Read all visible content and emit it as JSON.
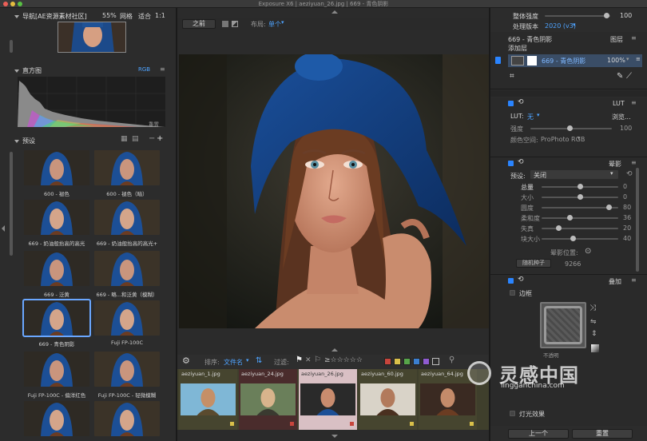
{
  "window": {
    "title": "Exposure X6 | aeziyuan_26.jpg | 669 - 青色阴影"
  },
  "navigator": {
    "title": "导航[AE资源素材社区]",
    "zoom": "55%",
    "grid": "网格",
    "fit": "适合",
    "ratio": "1:1"
  },
  "histogram": {
    "title": "直方图",
    "mode": "RGB",
    "reset": "重置"
  },
  "presets": {
    "title": "预设",
    "items": [
      {
        "label": "600 - 褪色"
      },
      {
        "label": "600 - 褪色（暗）"
      },
      {
        "label": "669 - 奶油般抬高的高光"
      },
      {
        "label": "669 - 奶油般抬高的高光+"
      },
      {
        "label": "669 - 泛黄"
      },
      {
        "label": "669 - 略...和泛黄（模糊）"
      },
      {
        "label": "669 - 青色阴影"
      },
      {
        "label": "Fuji FP-100C"
      },
      {
        "label": "Fuji FP-100C - 偏洋红色"
      },
      {
        "label": "Fuji FP-100C - 轻微模糊"
      },
      {
        "label": ""
      },
      {
        "label": ""
      }
    ]
  },
  "viewer": {
    "before": "之前",
    "layout_label": "布局:",
    "layout_value": "单个"
  },
  "filmstrip": {
    "sort_label": "排序:",
    "sort_value": "文件名",
    "filter_label": "过滤:",
    "files": [
      {
        "name": "aeziyuan_1.jpg"
      },
      {
        "name": "aeziyuan_24.jpg"
      },
      {
        "name": "aeziyuan_26.jpg"
      },
      {
        "name": "aeziyuan_60.jpg"
      },
      {
        "name": "aeziyuan_64.jpg"
      }
    ],
    "color_labels": [
      "#c8453c",
      "#d9c04a",
      "#57a54a",
      "#3b7fd1",
      "#8f5bd1"
    ]
  },
  "right": {
    "overall_intensity_label": "整体强度",
    "overall_intensity_value": "100",
    "process_version_label": "处理版本",
    "process_version_value": "2020 (v3)",
    "layers_title": "669 - 青色阴影",
    "layers_label": "图层",
    "add_layer": "添加层",
    "layer_name": "669 - 青色阴影",
    "layer_opacity": "100%",
    "lut": {
      "title": "LUT",
      "lut_label": "LUT:",
      "lut_value": "无",
      "browse": "浏览...",
      "strength_label": "强度",
      "strength_value": "100",
      "colorspace_label": "颜色空间:",
      "colorspace_value": "ProPhoto RGB"
    },
    "vignette": {
      "title": "晕影",
      "preset_label": "预设:",
      "preset_value": "关闭",
      "rows": [
        {
          "label": "总量",
          "value": "0",
          "level": 0.5
        },
        {
          "label": "大小",
          "value": "0",
          "level": 0.5
        },
        {
          "label": "圆度",
          "value": "80",
          "level": 0.9
        },
        {
          "label": "柔和度",
          "value": "36",
          "level": 0.36
        },
        {
          "label": "失真",
          "value": "20",
          "level": 0.2
        },
        {
          "label": "块大小",
          "value": "40",
          "level": 0.4
        }
      ],
      "position_label": "晕影位置:",
      "random_seed_label": "随机种子",
      "random_seed_value": "9266"
    },
    "overlay": {
      "title": "叠加",
      "border_label": "边框",
      "opacity_hint": "不透明",
      "light_effect_label": "灯光效果"
    },
    "prev_button": "上一个",
    "reset_button": "重置"
  },
  "watermark": {
    "brand": "灵感中国",
    "url": "lingganchina.com"
  }
}
